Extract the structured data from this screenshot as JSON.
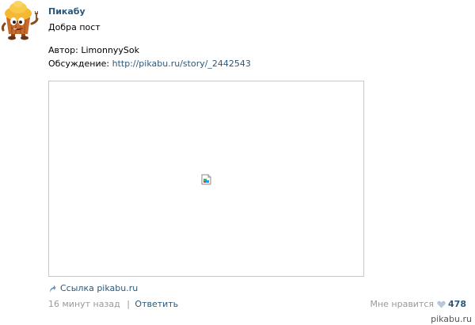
{
  "post": {
    "author": "Пикабу",
    "text": "Добра пост",
    "author_label": "Автор:",
    "author_value": "LimonnyySok",
    "discussion_label": "Обсуждение:",
    "discussion_link": "http://pikabu.ru/story/_2442543",
    "avatar_icon": "cupcake-mascot-icon",
    "image_icon": "broken-image-icon"
  },
  "share": {
    "icon": "share-arrow-icon",
    "label": "Ссылка pikabu.ru"
  },
  "footer": {
    "time": "16 минут назад",
    "separator": "|",
    "reply_label": "Ответить",
    "like_label": "Мне нравится",
    "like_icon": "heart-icon",
    "like_count": "478"
  },
  "watermark": "pikabu.ru",
  "colors": {
    "link": "#2b587a",
    "muted": "#999999",
    "border": "#c8c8c8"
  }
}
